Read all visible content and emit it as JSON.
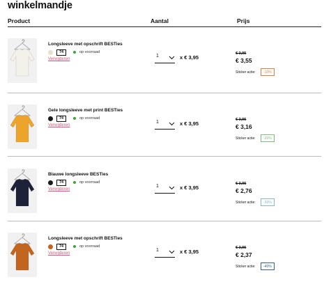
{
  "page": {
    "title": "winkelmandje"
  },
  "columns": {
    "product": "Product",
    "quantity": "Aantal",
    "price": "Prijs"
  },
  "items": [
    {
      "name": "Longsleeve met opschrift BESTies",
      "swatch_color": "#e8dfcf",
      "size": "74",
      "stock": "op voorraad",
      "remove_label": "Verwijderen",
      "quantity": "1",
      "unit_price": "x € 3,95",
      "old_price": "€ 3,95",
      "new_price": "€ 3,55",
      "sticker_label": "Sticker actie:",
      "sticker_value": "-10%",
      "sticker_color": "#e0803f",
      "product_color": "#f4f1ea"
    },
    {
      "name": "Gele longsleeve met print BESTies",
      "swatch_color": "#1a1a1a",
      "size": "74",
      "stock": "op voorraad",
      "remove_label": "Verwijderen",
      "quantity": "1",
      "unit_price": "x € 3,95",
      "old_price": "€ 3,95",
      "new_price": "€ 3,16",
      "sticker_label": "Sticker actie:",
      "sticker_value": "-20%",
      "sticker_color": "#7bbf7b",
      "product_color": "#eca52a"
    },
    {
      "name": "Blauwe longsleeve BESTies",
      "swatch_color": "#1a1a1a",
      "size": "74",
      "stock": "op voorraad",
      "remove_label": "Verwijderen",
      "quantity": "1",
      "unit_price": "x € 3,95",
      "old_price": "€ 3,95",
      "new_price": "€ 2,76",
      "sticker_label": "Sticker actie:",
      "sticker_value": "-30%",
      "sticker_color": "#7fb8c9",
      "product_color": "#1d2238"
    },
    {
      "name": "Longsleeve met opschrift BESTies",
      "swatch_color": "#c2651e",
      "size": "74",
      "stock": "op voorraad",
      "remove_label": "Verwijderen",
      "quantity": "1",
      "unit_price": "x € 3,95",
      "old_price": "€ 3,95",
      "new_price": "€ 2,37",
      "sticker_label": "Sticker actie:",
      "sticker_value": "-40%",
      "sticker_color": "#2f5f8a",
      "product_color": "#c2651e"
    }
  ]
}
